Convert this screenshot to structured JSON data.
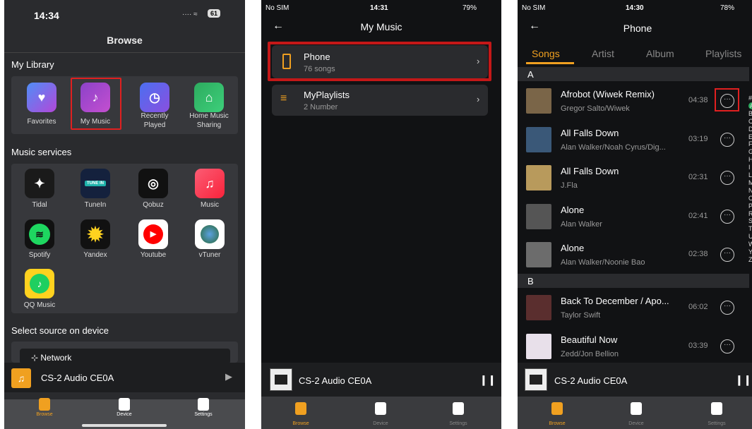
{
  "screen1": {
    "status_time": "14:34",
    "status_icons": "···· ≈",
    "battery": "61",
    "title": "Browse",
    "my_library_heading": "My Library",
    "library_items": [
      {
        "label": "Favorites",
        "icon": "favorites-icon",
        "color": "#7a4bd6"
      },
      {
        "label": "My Music",
        "icon": "my-music-icon",
        "color": "#8b42c9"
      },
      {
        "label": "Recently\nPlayed",
        "icon": "recently-played-icon",
        "color": "#5860e0"
      },
      {
        "label": "Home Music\nSharing",
        "icon": "home-music-sharing-icon",
        "color": "#2dab5f"
      }
    ],
    "music_services_heading": "Music services",
    "services": [
      {
        "label": "Tidal",
        "icon": "tidal-icon"
      },
      {
        "label": "TuneIn",
        "icon": "tunein-icon"
      },
      {
        "label": "Qobuz",
        "icon": "qobuz-icon"
      },
      {
        "label": "Music",
        "icon": "apple-music-icon"
      },
      {
        "label": "Spotify",
        "icon": "spotify-icon"
      },
      {
        "label": "Yandex",
        "icon": "yandex-icon"
      },
      {
        "label": "Youtube",
        "icon": "youtube-icon"
      },
      {
        "label": "vTuner",
        "icon": "vtuner-icon"
      },
      {
        "label": "QQ Music",
        "icon": "qq-music-icon"
      }
    ],
    "tunein_badge": "TUNE IN",
    "select_source_heading": "Select source on device",
    "network_label": "Network",
    "now_playing": "CS-2 Audio CE0A",
    "tabs": [
      "Browse",
      "Device",
      "Settings"
    ],
    "highlight_color": "#e02020",
    "accent_color": "#f0a020"
  },
  "screen2": {
    "carrier": "No SIM",
    "status_time": "14:31",
    "battery": "79%",
    "title": "My Music",
    "items": [
      {
        "title": "Phone",
        "subtitle": "76 songs"
      },
      {
        "title": "MyPlaylists",
        "subtitle": "2 Number"
      }
    ],
    "now_playing": "CS-2 Audio CE0A",
    "tabs": [
      "Browse",
      "Device",
      "Settings"
    ]
  },
  "screen3": {
    "carrier": "No SIM",
    "status_time": "14:30",
    "battery": "78%",
    "title": "Phone",
    "tabs_top": [
      "Songs",
      "Artist",
      "Album",
      "Playlists"
    ],
    "section_a": "A",
    "section_b": "B",
    "songs_a": [
      {
        "title": "Afrobot (Wiwek Remix)",
        "artist": "Gregor Salto/Wiwek",
        "duration": "04:38",
        "cover": "#7a6548"
      },
      {
        "title": "All Falls Down",
        "artist": "Alan Walker/Noah Cyrus/Dig...",
        "duration": "03:19",
        "cover": "#3a5878"
      },
      {
        "title": "All Falls Down",
        "artist": "J.Fla",
        "duration": "02:31",
        "cover": "#b89a5c"
      },
      {
        "title": "Alone",
        "artist": "Alan Walker",
        "duration": "02:41",
        "cover": "#555555"
      },
      {
        "title": "Alone",
        "artist": "Alan Walker/Noonie Bao",
        "duration": "02:38",
        "cover": "#6c6c6c"
      }
    ],
    "songs_b": [
      {
        "title": "Back To December / Apo...",
        "artist": "Taylor Swift",
        "duration": "06:02",
        "cover": "#5a2e2e"
      },
      {
        "title": "Beautiful Now",
        "artist": "Zedd/Jon Bellion",
        "duration": "03:39",
        "cover": "#e8e0ea"
      }
    ],
    "index_letters": [
      "#",
      "A",
      "B",
      "C",
      "D",
      "E",
      "F",
      "G",
      "H",
      "I",
      "L",
      "M",
      "N",
      "O",
      "P",
      "R",
      "S",
      "T",
      "U",
      "W",
      "Y",
      "Z"
    ],
    "now_playing": "CS-2 Audio CE0A",
    "bottom_tabs": [
      "Browse",
      "Device",
      "Settings"
    ]
  }
}
